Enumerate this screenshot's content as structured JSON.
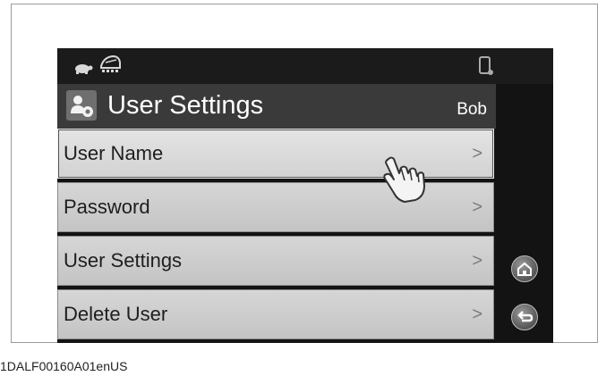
{
  "screen": {
    "title": "User Settings",
    "user": "Bob"
  },
  "status_icons": [
    "turtle-icon",
    "machine-icon",
    "phone-icon"
  ],
  "menu": {
    "items": [
      {
        "label": "User Name",
        "chevron": ">"
      },
      {
        "label": "Password",
        "chevron": ">"
      },
      {
        "label": "User Settings",
        "chevron": ">"
      },
      {
        "label": "Delete User",
        "chevron": ">"
      }
    ]
  },
  "side_buttons": [
    "home-icon",
    "back-icon"
  ],
  "caption": "1DALF00160A01enUS",
  "colors": {
    "device_bg": "#131313",
    "header_bg": "#3a3a3a",
    "menu_item_bg": "#cccccc",
    "text_dark": "#1e1e1e",
    "text_light": "#ffffff"
  }
}
